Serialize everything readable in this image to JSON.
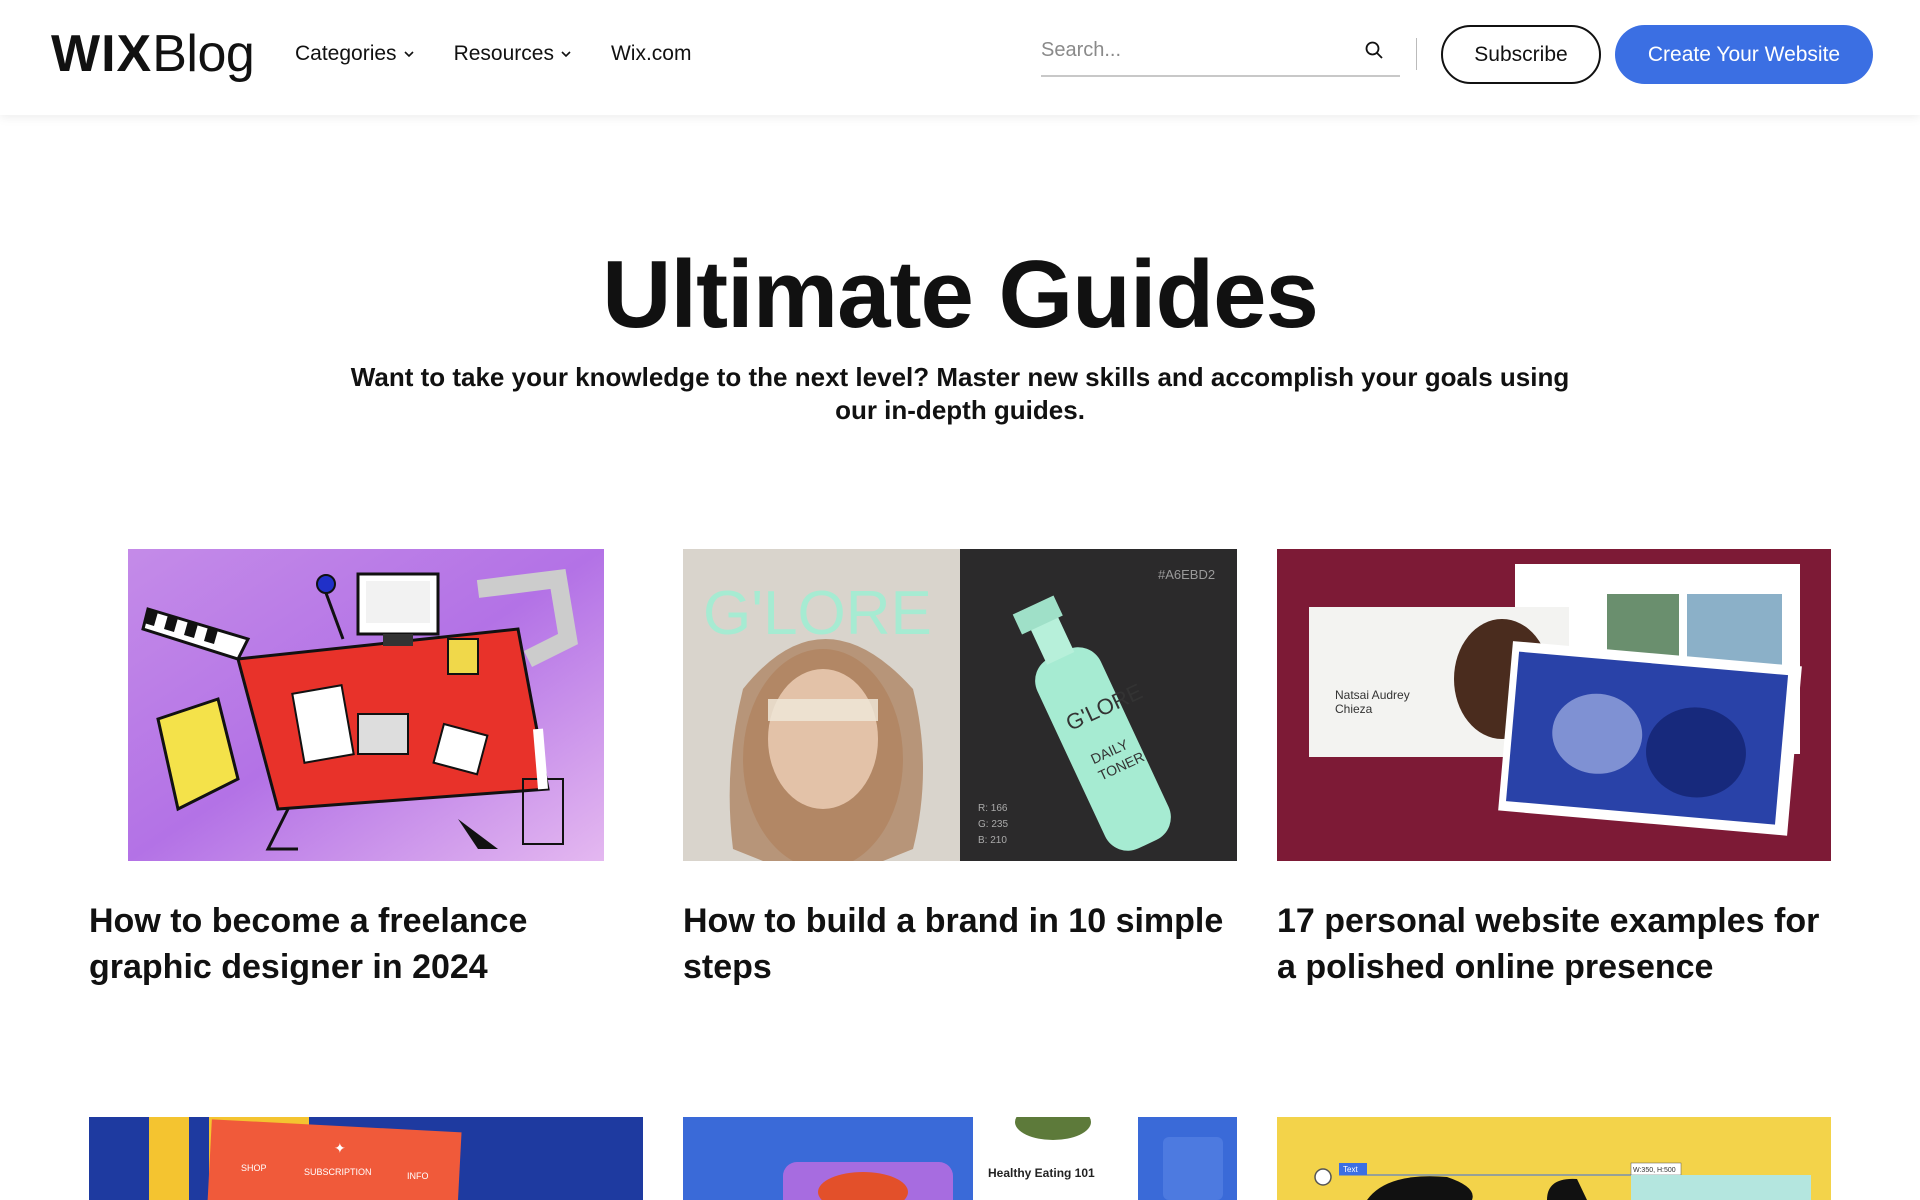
{
  "header": {
    "logo_bold": "WIX",
    "logo_light": "Blog",
    "nav": [
      {
        "label": "Categories",
        "has_dropdown": true
      },
      {
        "label": "Resources",
        "has_dropdown": true
      },
      {
        "label": "Wix.com",
        "has_dropdown": false
      }
    ],
    "search_placeholder": "Search...",
    "subscribe_label": "Subscribe",
    "create_label": "Create Your Website",
    "accent_color": "#3b6fe3"
  },
  "hero": {
    "title": "Ultimate Guides",
    "subtitle": "Want to take your knowledge to the next level? Master new skills and accomplish your goals using our in-depth guides."
  },
  "cards": [
    {
      "title": "How to become a freelance graphic designer in 2024",
      "image": "illustration-desk"
    },
    {
      "title": "How to build a brand in 10 simple steps",
      "image": "brand-glore",
      "image_text": {
        "brand": "G'LORE",
        "hex": "#A6EBD2",
        "r": "R: 166",
        "g": "G: 235",
        "b": "B: 210",
        "bottle_line1": "DAILY",
        "bottle_line2": "TONER"
      }
    },
    {
      "title": "17 personal website examples for a polished online presence",
      "image": "personal-website",
      "image_text": {
        "name_line1": "Natsai Audrey",
        "name_line2": "Chieza"
      }
    },
    {
      "title": "",
      "image": "blue-orange-poster",
      "image_text": {
        "shop": "SHOP",
        "subscription": "SUBSCRIPTION",
        "info": "INFO"
      }
    },
    {
      "title": "",
      "image": "healthy-eating",
      "image_text": {
        "label": "Healthy Eating 101"
      }
    },
    {
      "title": "",
      "image": "yellow-editor",
      "image_text": {
        "tag": "Text",
        "size": "W:350, H:500"
      }
    }
  ]
}
